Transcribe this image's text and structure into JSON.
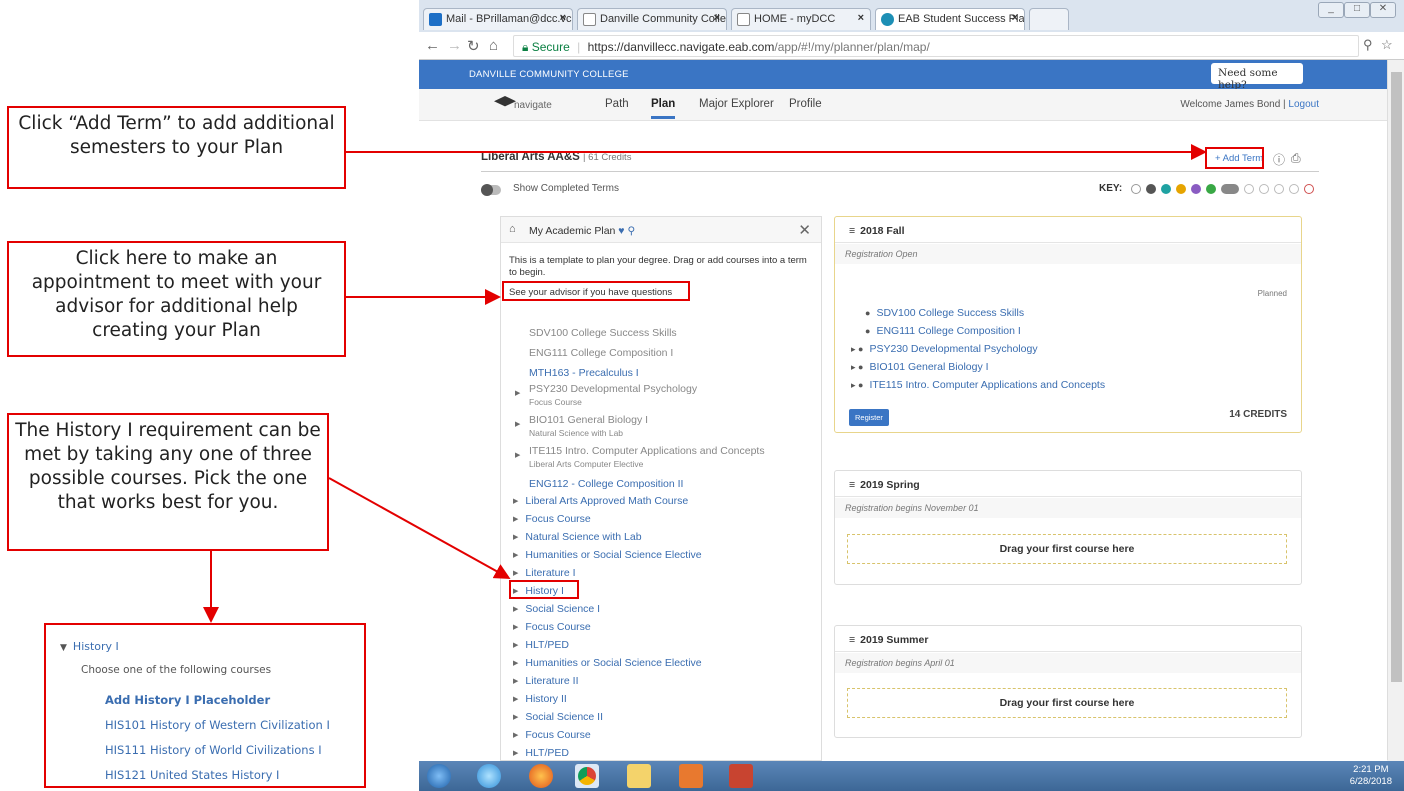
{
  "annotations": {
    "add_term_note": "Click “Add Term” to add additional semesters to your Plan",
    "advisor_note": "Click here to make an appointment to meet with your advisor for additional help creating your Plan",
    "history_note": "The History I requirement can be met by taking any one of three possible courses.  Pick the one that works best for you."
  },
  "history_callout": {
    "heading": "History I",
    "subheading": "Choose one of the following courses",
    "items": [
      "Add History I Placeholder",
      "HIS101 History of Western Civilization I",
      "HIS111 History of World Civilizations I",
      "HIS121 United States History I"
    ]
  },
  "browser": {
    "tabs": [
      "Mail - BPrillaman@dcc.vc",
      "Danville Community Colle",
      "HOME - myDCC",
      "EAB Student Success Pla"
    ],
    "url_secure": "Secure",
    "url_host": "https://danvillecc.navigate.eab.com",
    "url_path": "/app/#!/my/planner/plan/map/"
  },
  "site": {
    "college": "DANVILLE COMMUNITY COLLEGE",
    "help": "Need some help?",
    "logo": "navigate",
    "nav": [
      "Path",
      "Plan",
      "Major Explorer",
      "Profile"
    ],
    "welcome": "Welcome James Bond |",
    "logout": "Logout"
  },
  "plan": {
    "title": "Liberal Arts AA&S",
    "credits": "| 61 Credits",
    "add_term": "+ Add Term",
    "show_completed": "Show Completed Terms",
    "key_label": "KEY:"
  },
  "academic_plan": {
    "title": "My Academic Plan",
    "intro": "This is a template to plan your degree. Drag or add courses into a term to begin.",
    "advisor_link": "See your advisor if you have questions",
    "courses": [
      {
        "name": "SDV100 College Success Skills",
        "sub": ""
      },
      {
        "name": "ENG111 College Composition I",
        "sub": ""
      },
      {
        "name": "MTH163 - Precalculus I",
        "sub": ""
      },
      {
        "name": "PSY230 Developmental Psychology",
        "sub": "Focus Course"
      },
      {
        "name": "BIO101 General Biology I",
        "sub": "Natural Science with Lab"
      },
      {
        "name": "ITE115 Intro. Computer Applications and Concepts",
        "sub": "Liberal Arts Computer Elective"
      },
      {
        "name": "ENG112 - College Composition II",
        "sub": ""
      }
    ],
    "requirements": [
      "Liberal Arts Approved Math Course",
      "Focus Course",
      "Natural Science with Lab",
      "Humanities or Social Science Elective",
      "Literature I",
      "History I",
      "Social Science I",
      "Focus Course",
      "HLT/PED",
      "Humanities or Social Science Elective",
      "Literature II",
      "History II",
      "Social Science II",
      "Focus Course",
      "HLT/PED"
    ]
  },
  "terms": [
    {
      "title": "2018 Fall",
      "status": "Registration Open",
      "planned_label": "Planned",
      "courses": [
        "SDV100 College Success Skills",
        "ENG111 College Composition I",
        "PSY230 Developmental Psychology",
        "BIO101 General Biology I",
        "ITE115 Intro. Computer Applications and Concepts"
      ],
      "register": "Register",
      "credits": "14 CREDITS"
    },
    {
      "title": "2019 Spring",
      "status": "Registration begins November 01",
      "drop": "Drag your first course here"
    },
    {
      "title": "2019 Summer",
      "status": "Registration begins April 01",
      "drop": "Drag your first course here"
    }
  ],
  "taskbar": {
    "time": "2:21 PM",
    "date": "6/28/2018"
  }
}
